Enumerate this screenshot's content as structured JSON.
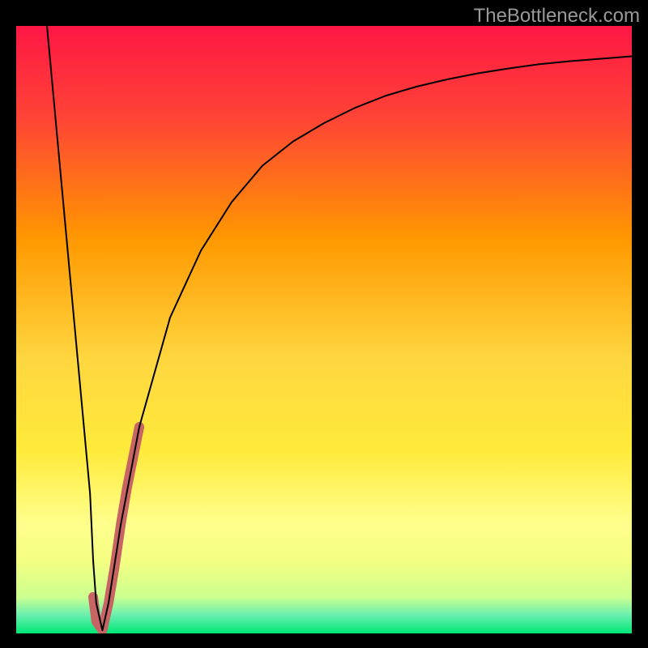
{
  "watermark": "TheBottleneck.com",
  "chart_data": {
    "type": "line",
    "title": "",
    "xlabel": "",
    "ylabel": "",
    "xlim": [
      0,
      100
    ],
    "ylim": [
      0,
      100
    ],
    "gradient_stops": [
      {
        "offset": 0,
        "color": "#ff1744"
      },
      {
        "offset": 0.15,
        "color": "#ff4336"
      },
      {
        "offset": 0.35,
        "color": "#ff9800"
      },
      {
        "offset": 0.55,
        "color": "#ffd740"
      },
      {
        "offset": 0.7,
        "color": "#ffeb3b"
      },
      {
        "offset": 0.82,
        "color": "#ffff8d"
      },
      {
        "offset": 0.88,
        "color": "#f4ff81"
      },
      {
        "offset": 0.94,
        "color": "#ccff90"
      },
      {
        "offset": 0.97,
        "color": "#69f0ae"
      },
      {
        "offset": 1.0,
        "color": "#00e676"
      }
    ],
    "series": [
      {
        "name": "main-curve",
        "color": "#000000",
        "width": 2,
        "x": [
          5,
          6,
          7,
          8,
          9,
          10,
          11,
          12,
          12.5,
          13,
          14,
          15,
          17,
          20,
          25,
          30,
          35,
          40,
          45,
          50,
          55,
          60,
          65,
          70,
          75,
          80,
          85,
          90,
          95,
          100
        ],
        "y": [
          100,
          89,
          78,
          67,
          56,
          45,
          34,
          23,
          12,
          5,
          0.5,
          5,
          18,
          34,
          52,
          63,
          71,
          77,
          81,
          84,
          86.5,
          88.5,
          90,
          91.2,
          92.2,
          93,
          93.7,
          94.2,
          94.6,
          95
        ]
      },
      {
        "name": "highlight-segment",
        "color": "#c86464",
        "width": 12,
        "x": [
          12.5,
          13,
          14,
          15,
          16,
          17,
          18,
          19,
          20
        ],
        "y": [
          6,
          2,
          0.5,
          5,
          11,
          18,
          24,
          29,
          34
        ]
      }
    ]
  }
}
